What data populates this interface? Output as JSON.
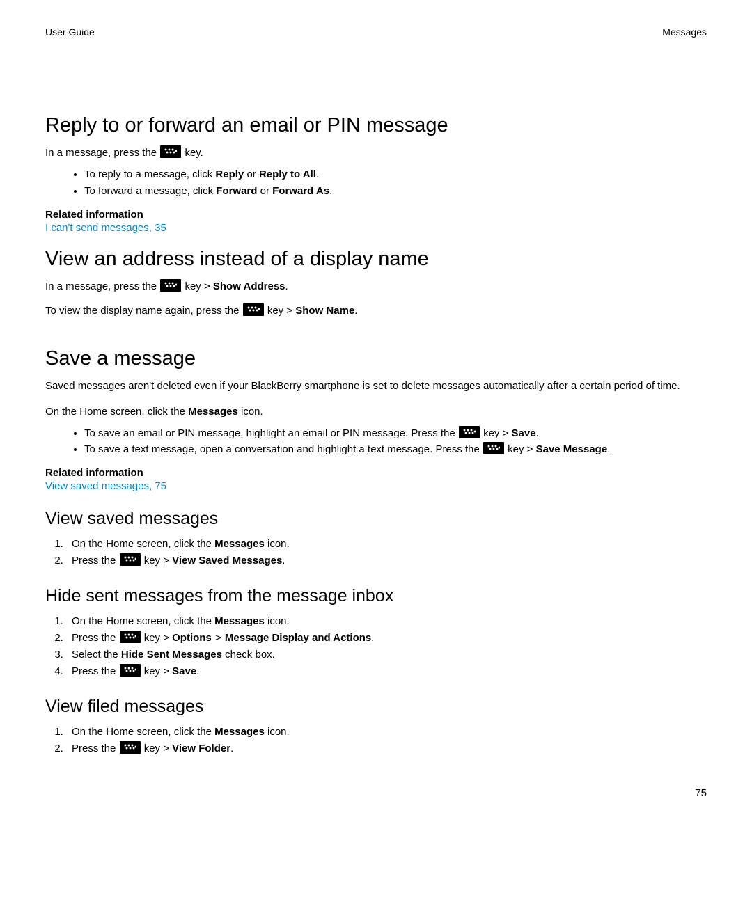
{
  "header": {
    "left": "User Guide",
    "right": "Messages"
  },
  "page_number": "75",
  "common": {
    "related_heading": "Related information",
    "key_word": " key",
    "key_arrow": " key > ",
    "arrow": " > ",
    "period": ".",
    "press_the": "Press the ",
    "in_msg_press": "In a message, press the ",
    "on_home_msgs_pre": "On the Home screen, click the ",
    "on_home_msgs_bold": "Messages",
    "on_home_msgs_post": " icon."
  },
  "s1": {
    "title": "Reply to or forward an email or PIN message",
    "b1": {
      "pre": "To reply to a message, click ",
      "a": "Reply",
      "mid": " or ",
      "b": "Reply to All"
    },
    "b2": {
      "pre": "To forward a message, click ",
      "a": "Forward",
      "mid": " or ",
      "b": "Forward As"
    },
    "link": "I can't send messages, 35"
  },
  "s2": {
    "title": "View an address instead of a display name",
    "l1_bold": "Show Address",
    "l2_pre": "To view the display name again, press the ",
    "l2_bold": "Show Name"
  },
  "s3": {
    "title": "Save a message",
    "intro": "Saved messages aren't deleted even if your BlackBerry smartphone is set to delete messages automatically after a certain period of time.",
    "b1": {
      "pre": "To save an email or PIN message, highlight an email or PIN message. Press the ",
      "bold": "Save"
    },
    "b2": {
      "pre": "To save a text message, open a conversation and highlight a text message. Press the ",
      "bold": "Save Message"
    },
    "link": "View saved messages, 75"
  },
  "s4": {
    "title": "View saved messages",
    "step2_bold": "View Saved Messages"
  },
  "s5": {
    "title": "Hide sent messages from the message inbox",
    "step2_a": "Options",
    "step2_b": "Message Display and Actions",
    "step3_pre": "Select the ",
    "step3_bold": "Hide Sent Messages",
    "step3_post": " check box.",
    "step4_bold": "Save"
  },
  "s6": {
    "title": "View filed messages",
    "step2_bold": "View Folder"
  }
}
